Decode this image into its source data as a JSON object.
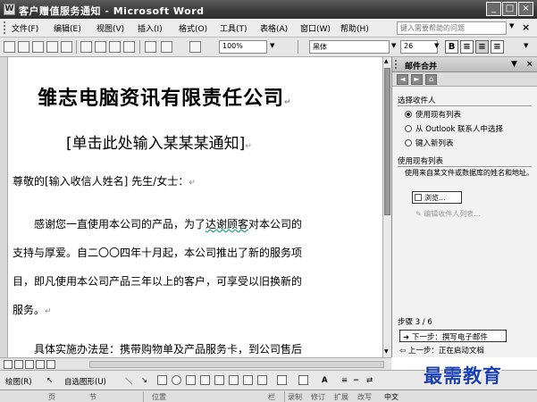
{
  "window": {
    "title": "客户赠值服务通知 - Microsoft Word",
    "minimize": "_",
    "maximize": "□",
    "close": "×"
  },
  "menubar": {
    "items": [
      "文件(F)",
      "编辑(E)",
      "视图(V)",
      "插入(I)",
      "格式(O)",
      "工具(T)",
      "表格(A)",
      "窗口(W)",
      "帮助(H)"
    ],
    "help_placeholder": "键入需要帮助的问题",
    "doc_close": "×"
  },
  "toolbar": {
    "zoom": "100%",
    "font": "黑体",
    "font_size": "26",
    "bold": "B"
  },
  "document": {
    "title": "雏志电脑资讯有限责任公司",
    "subtitle": "[单击此处输入某某某通知]",
    "salutation": "尊敬的[输入收信人姓名] 先生/女士：",
    "para1_line1a": "　　感谢您一直使用本公司的产品，为了",
    "para1_line1b": "达谢顾客",
    "para1_line1c": "对本公司的",
    "para1_line2": "支持与厚爱。自二〇〇四年十月起，本公司推出了新的服务项",
    "para1_line3": "目，即凡使用本公司产品三年以上的客户，可享受以旧换新的",
    "para1_line4": "服务。",
    "para2_line1": "　　具体实施办法是：携带购物单及产品服务卡，到公司售后",
    "para_mark": "↵"
  },
  "taskpane": {
    "title": "邮件合并",
    "section_recipients": "选择收件人",
    "option_existing": "使用现有列表",
    "option_outlook": "从 Outlook 联系人中选择",
    "option_new": "键入新列表",
    "section_existing": "使用现有列表",
    "description": "使用来自某文件或数据库的姓名和地址。",
    "browse": "浏览...",
    "edit_list": "编辑收件人列表...",
    "step": "步骤 3 / 6",
    "next": "下一步：撰写电子邮件",
    "prev": "上一步：正在启动文档"
  },
  "drawbar": {
    "draw": "绘图(R)",
    "autoshapes": "自选图形(U)"
  },
  "statusbar": {
    "page": "页",
    "section": "节",
    "position": "位置",
    "col": "栏",
    "rec": "录制",
    "trk": "修订",
    "ext": "扩展",
    "ovr": "改写",
    "lang": "中文"
  },
  "watermark": "最需教育",
  "colors": {
    "watermark": "#1a3fb0",
    "titlebar": "#3a3a3a"
  }
}
